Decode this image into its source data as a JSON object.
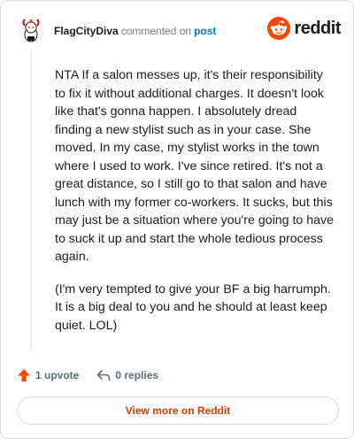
{
  "header": {
    "author": "FlagCityDiva",
    "action": "commented on",
    "post_link": "post",
    "brand": "reddit"
  },
  "comment": {
    "paragraphs": [
      "NTA If a salon messes up, it's their responsibility to fix it without additional charges. It doesn't look like that's gonna happen. I absolutely dread finding a new stylist such as in your case. She moved. In my case, my stylist works in the town where I used to work. I've since retired. It's not a great distance, so I still go to that salon and have lunch with my former co-workers. It sucks, but this may just be a situation where you're going to have to suck it up and start the whole tedious process again.",
      "(I'm very tempted to give your BF a big harrumph. It is a big deal to you and he should at least keep quiet. LOL)"
    ]
  },
  "footer": {
    "upvotes": "1 upvote",
    "replies": "0 replies"
  },
  "view_more": "View more on Reddit",
  "colors": {
    "brand": "#ff4500",
    "link": "#0079d3",
    "cta": "#d93a00",
    "muted": "#576f76"
  }
}
